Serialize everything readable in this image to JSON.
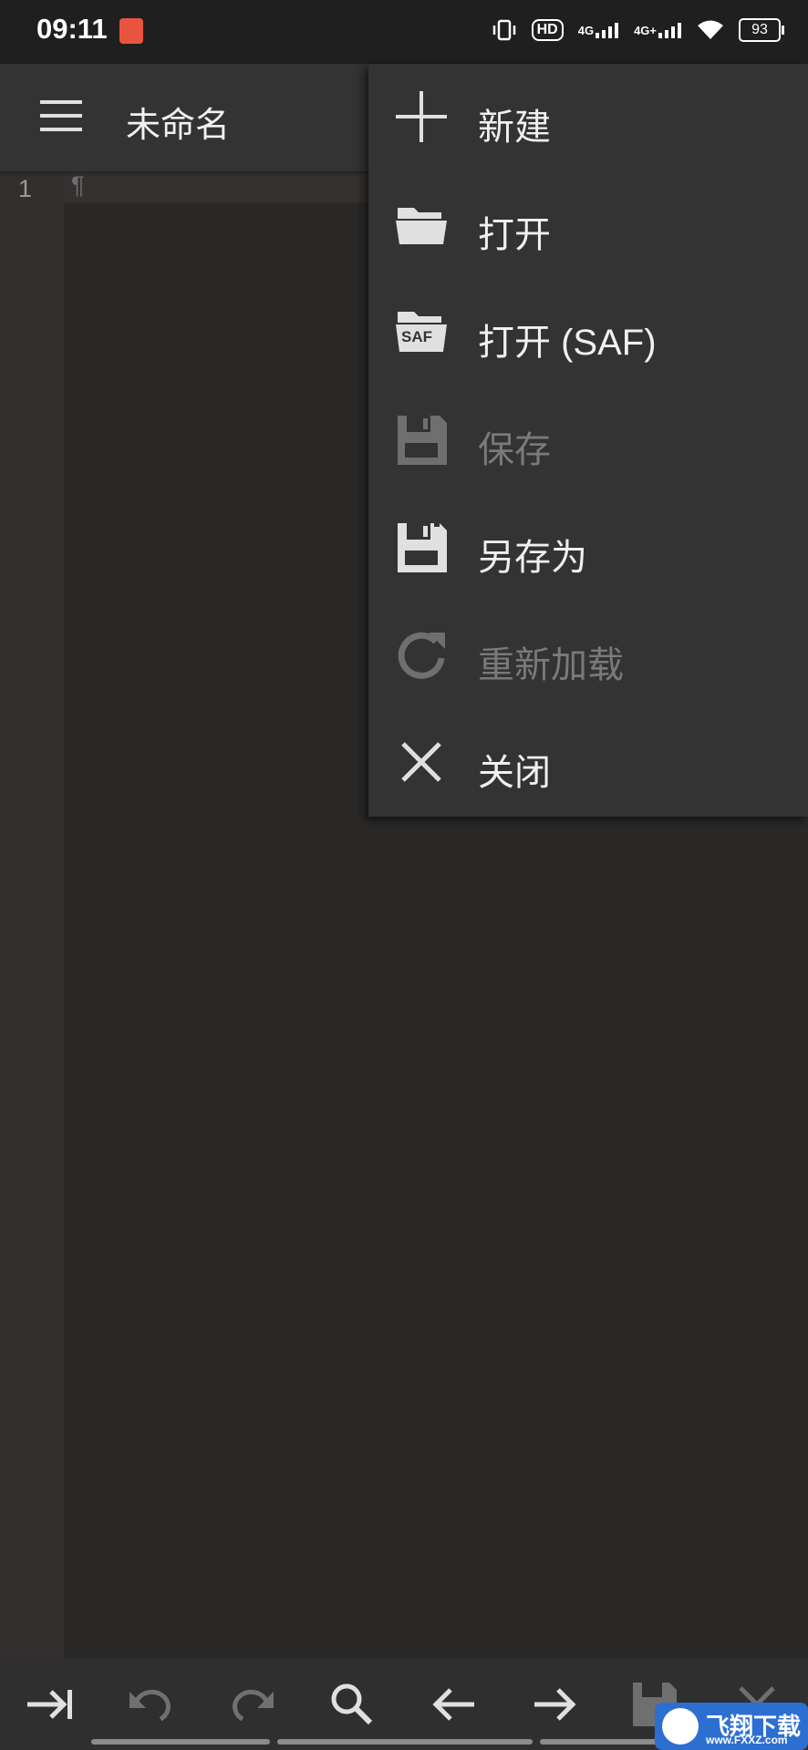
{
  "status_bar": {
    "time": "09:11",
    "signal_1": "4G",
    "signal_2": "4G+",
    "hd_label": "HD",
    "battery": "93"
  },
  "toolbar": {
    "title": "未命名",
    "menu_icon": "hamburger-icon"
  },
  "editor": {
    "line_number": "1",
    "content_marker": "¶"
  },
  "file_menu": {
    "items": [
      {
        "label": "新建",
        "icon": "plus-icon",
        "enabled": true
      },
      {
        "label": "打开",
        "icon": "folder-open-icon",
        "enabled": true
      },
      {
        "label": "打开 (SAF)",
        "icon": "folder-saf-icon",
        "enabled": true
      },
      {
        "label": "保存",
        "icon": "save-icon",
        "enabled": false
      },
      {
        "label": "另存为",
        "icon": "save-as-icon",
        "enabled": true
      },
      {
        "label": "重新加载",
        "icon": "reload-icon",
        "enabled": false
      },
      {
        "label": "关闭",
        "icon": "close-icon",
        "enabled": true
      }
    ],
    "saf_badge": "SAF"
  },
  "bottom_toolbar": {
    "buttons": [
      "tab-indent-icon",
      "undo-icon",
      "redo-icon",
      "search-icon",
      "arrow-left-icon",
      "arrow-right-icon",
      "save-icon",
      "close-icon"
    ]
  },
  "watermark": {
    "text": "飞翔下载",
    "url": "www.FXXZ.com"
  },
  "colors": {
    "background": "#2b2928",
    "toolbar": "#333333",
    "menu": "#333333",
    "text": "#f0f0f0",
    "disabled_text": "#7a7a7a"
  }
}
